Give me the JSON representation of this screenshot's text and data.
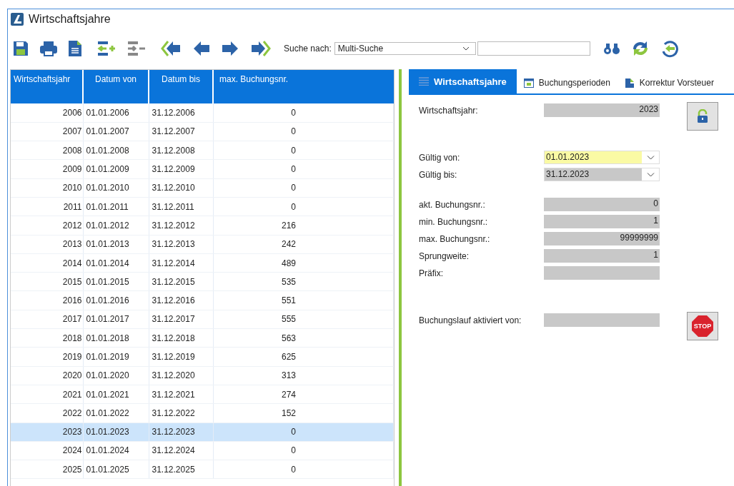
{
  "window": {
    "title": "Wirtschaftsjahre"
  },
  "toolbar": {
    "search_label": "Suche nach:",
    "search_mode": "Multi-Suche"
  },
  "table": {
    "columns": [
      "Wirtschaftsjahr",
      "Datum von",
      "Datum bis",
      "max. Buchungsnr."
    ],
    "rows": [
      {
        "year": "2006",
        "from": "01.01.2006",
        "to": "31.12.2006",
        "max": "0",
        "selected": false
      },
      {
        "year": "2007",
        "from": "01.01.2007",
        "to": "31.12.2007",
        "max": "0",
        "selected": false
      },
      {
        "year": "2008",
        "from": "01.01.2008",
        "to": "31.12.2008",
        "max": "0",
        "selected": false
      },
      {
        "year": "2009",
        "from": "01.01.2009",
        "to": "31.12.2009",
        "max": "0",
        "selected": false
      },
      {
        "year": "2010",
        "from": "01.01.2010",
        "to": "31.12.2010",
        "max": "0",
        "selected": false
      },
      {
        "year": "2011",
        "from": "01.01.2011",
        "to": "31.12.2011",
        "max": "0",
        "selected": false
      },
      {
        "year": "2012",
        "from": "01.01.2012",
        "to": "31.12.2012",
        "max": "216",
        "selected": false
      },
      {
        "year": "2013",
        "from": "01.01.2013",
        "to": "31.12.2013",
        "max": "242",
        "selected": false
      },
      {
        "year": "2014",
        "from": "01.01.2014",
        "to": "31.12.2014",
        "max": "489",
        "selected": false
      },
      {
        "year": "2015",
        "from": "01.01.2015",
        "to": "31.12.2015",
        "max": "535",
        "selected": false
      },
      {
        "year": "2016",
        "from": "01.01.2016",
        "to": "31.12.2016",
        "max": "551",
        "selected": false
      },
      {
        "year": "2017",
        "from": "01.01.2017",
        "to": "31.12.2017",
        "max": "555",
        "selected": false
      },
      {
        "year": "2018",
        "from": "01.01.2018",
        "to": "31.12.2018",
        "max": "563",
        "selected": false
      },
      {
        "year": "2019",
        "from": "01.01.2019",
        "to": "31.12.2019",
        "max": "625",
        "selected": false
      },
      {
        "year": "2020",
        "from": "01.01.2020",
        "to": "31.12.2020",
        "max": "313",
        "selected": false
      },
      {
        "year": "2021",
        "from": "01.01.2021",
        "to": "31.12.2021",
        "max": "274",
        "selected": false
      },
      {
        "year": "2022",
        "from": "01.01.2022",
        "to": "31.12.2022",
        "max": "152",
        "selected": false
      },
      {
        "year": "2023",
        "from": "01.01.2023",
        "to": "31.12.2023",
        "max": "0",
        "selected": true
      },
      {
        "year": "2024",
        "from": "01.01.2024",
        "to": "31.12.2024",
        "max": "0",
        "selected": false
      },
      {
        "year": "2025",
        "from": "01.01.2025",
        "to": "31.12.2025",
        "max": "0",
        "selected": false
      }
    ]
  },
  "tabs": [
    {
      "label": "Wirtschaftsjahre",
      "selected": true
    },
    {
      "label": "Buchungsperioden",
      "selected": false
    },
    {
      "label": "Korrektur Vorsteuer",
      "selected": false
    }
  ],
  "form": [
    {
      "button": {
        "kind": "lock"
      },
      "fields": [
        {
          "label": "Wirtschaftsjahr:",
          "value": "2023",
          "kind": "text",
          "highlighted": false
        }
      ]
    },
    {
      "fields": [
        {
          "label": "Gültig von:",
          "value": "01.01.2023",
          "kind": "date",
          "highlighted": true
        },
        {
          "label": "Gültig bis:",
          "value": "31.12.2023",
          "kind": "date",
          "highlighted": false
        }
      ]
    },
    {
      "fields": [
        {
          "label": "akt. Buchungsnr.:",
          "value": "0",
          "kind": "text",
          "highlighted": false
        },
        {
          "label": "min. Buchungsnr.:",
          "value": "1",
          "kind": "text",
          "highlighted": false
        },
        {
          "label": "max. Buchungsnr.:",
          "value": "99999999",
          "kind": "text",
          "highlighted": false
        },
        {
          "label": "Sprungweite:",
          "value": "1",
          "kind": "text",
          "highlighted": false
        },
        {
          "label": "Präfix:",
          "kind": "text",
          "highlighted": false
        }
      ]
    },
    {
      "button": {
        "kind": "stop",
        "label": "STOP"
      },
      "fields": [
        {
          "label": "Buchungslauf aktiviert von:",
          "kind": "text",
          "highlighted": false
        }
      ]
    }
  ]
}
